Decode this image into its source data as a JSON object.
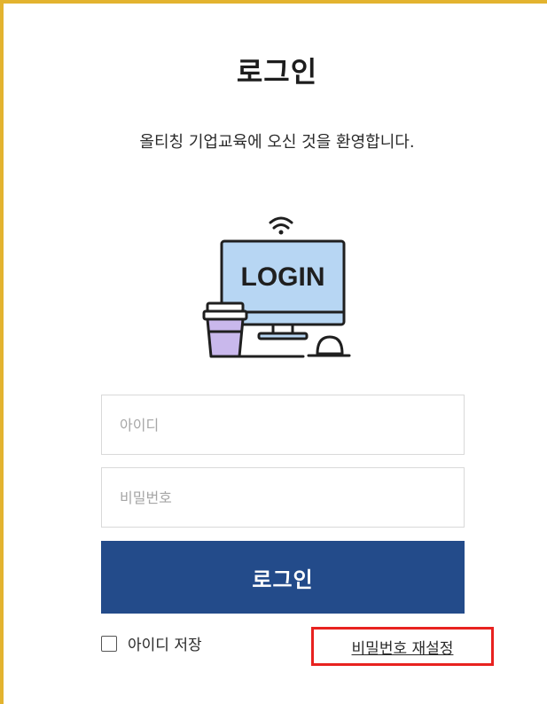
{
  "header": {
    "title": "로그인",
    "subtitle": "올티칭 기업교육에 오신 것을 환영합니다."
  },
  "illustration": {
    "screen_text": "LOGIN",
    "icon": "computer-login-illustration"
  },
  "form": {
    "id_placeholder": "아이디",
    "password_placeholder": "비밀번호",
    "login_label": "로그인",
    "remember_label": "아이디 저장",
    "remember_checked": false,
    "reset_link": "비밀번호 재설정"
  },
  "colors": {
    "accent_border": "#e3b32f",
    "button": "#234b8a",
    "highlight": "#e8221f",
    "screen": "#b7d6f3",
    "cup": "#c9b8ec"
  }
}
